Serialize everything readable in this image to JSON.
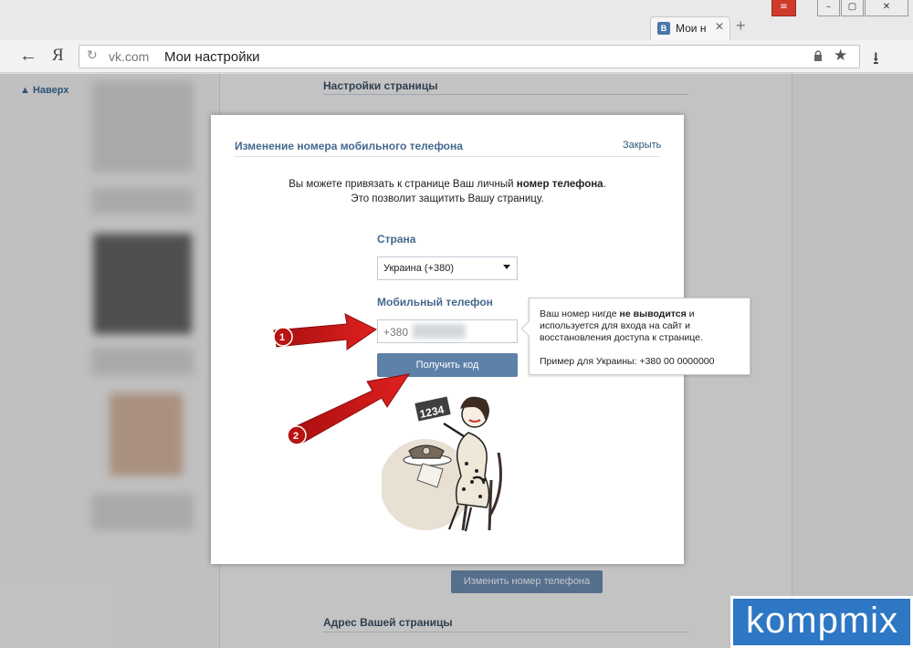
{
  "browser": {
    "tab_title": "Мои н",
    "tab_favicon": "В",
    "tab_close": "✕",
    "new_tab": "+",
    "url_domain": "vk.com",
    "url_title": "Мои настройки",
    "ya_logo": "Я",
    "back": "←",
    "reload": "↻",
    "star": "★",
    "download": "⭳",
    "win_menu": "≡",
    "win_min": "–",
    "win_max": "▢",
    "win_close": "✕"
  },
  "sidebar": {
    "up_link": "▲ Наверх"
  },
  "page": {
    "section_settings": "Настройки страницы",
    "section_address": "Адрес Вашей страницы",
    "change_phone_button": "Изменить номер телефона"
  },
  "modal": {
    "title": "Изменение номера мобильного телефона",
    "close": "Закрыть",
    "intro_part1": "Вы можете привязать к странице Ваш личный ",
    "intro_bold": "номер телефона",
    "intro_part2": ".",
    "intro_line2": "Это позволит защитить Вашу страницу.",
    "country_label": "Страна",
    "country_value": "Украина (+380)",
    "phone_label": "Мобильный телефон",
    "phone_value": "+380",
    "get_code_button": "Получить код",
    "illustration_number": "1234"
  },
  "tooltip": {
    "text_part1": "Ваш номер нигде ",
    "text_bold": "не выводится",
    "text_part2": " и используется для входа на сайт и восстановления доступа к странице.",
    "example": "Пример для Украины: +380 00 0000000"
  },
  "annotations": {
    "step1": "1",
    "step2": "2",
    "arrow_color": "#d81b1b"
  },
  "watermark": {
    "text": "kompmix"
  },
  "colors": {
    "vk_blue": "#45688e",
    "button_blue": "#5e81a8",
    "link_blue": "#2b587a"
  }
}
